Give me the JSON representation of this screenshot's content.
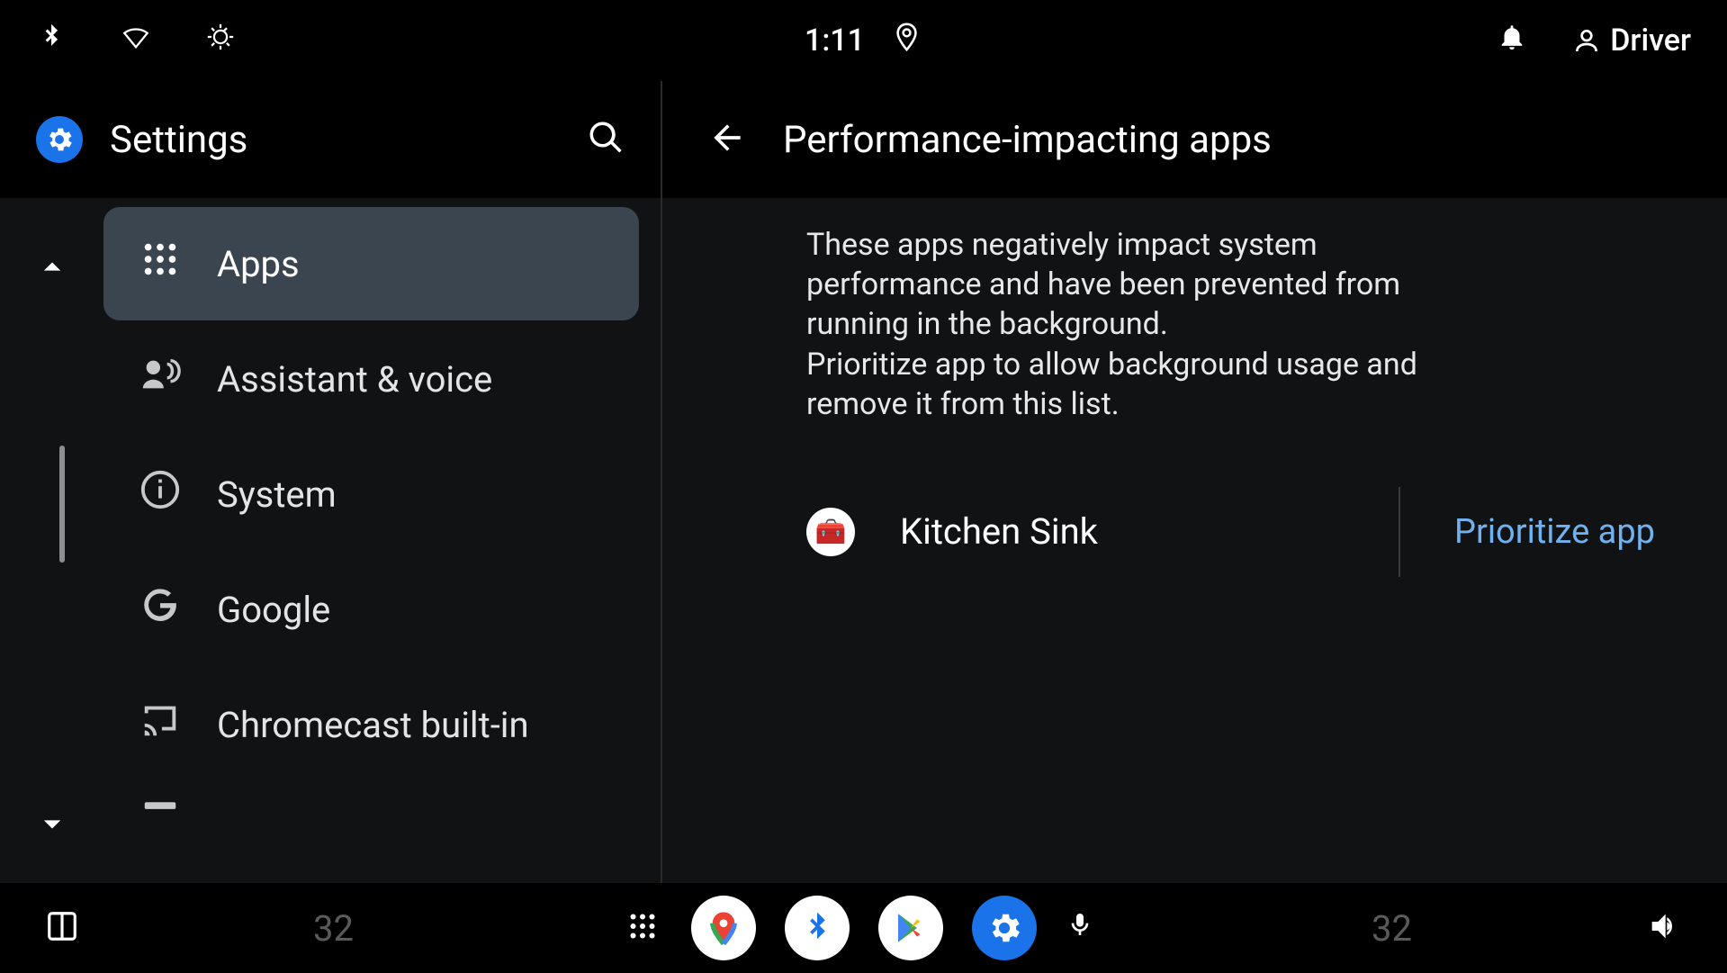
{
  "statusbar": {
    "time": "1:11",
    "user_label": "Driver"
  },
  "left": {
    "title": "Settings",
    "items": [
      {
        "label": "Apps",
        "icon": "apps-grid-icon",
        "selected": true
      },
      {
        "label": "Assistant & voice",
        "icon": "assistant-voice-icon",
        "selected": false
      },
      {
        "label": "System",
        "icon": "info-icon",
        "selected": false
      },
      {
        "label": "Google",
        "icon": "google-g-icon",
        "selected": false
      },
      {
        "label": "Chromecast built-in",
        "icon": "cast-icon",
        "selected": false
      }
    ]
  },
  "right": {
    "title": "Performance-impacting apps",
    "description_line1": "These apps negatively impact system performance and have been prevented from running in the background.",
    "description_line2": "Prioritize app to allow background usage and remove it from this list.",
    "apps": [
      {
        "name": "Kitchen Sink",
        "action_label": "Prioritize app"
      }
    ]
  },
  "bottombar": {
    "temp_left": "32",
    "temp_right": "32"
  }
}
